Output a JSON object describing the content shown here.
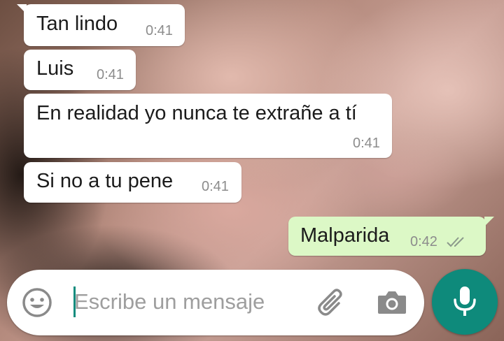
{
  "messages": [
    {
      "text": "Tan lindo",
      "time": "0:41",
      "direction": "incoming"
    },
    {
      "text": "Luis",
      "time": "0:41",
      "direction": "incoming"
    },
    {
      "text": "En realidad yo nunca te extrañe a tí",
      "time": "0:41",
      "direction": "incoming"
    },
    {
      "text": "Si no a tu pene",
      "time": "0:41",
      "direction": "incoming"
    },
    {
      "text": "Malparida",
      "time": "0:42",
      "direction": "outgoing",
      "status": "delivered"
    }
  ],
  "composer": {
    "placeholder": "Escribe un mensaje",
    "icons": [
      "smiley-icon",
      "paperclip-icon",
      "camera-icon",
      "microphone-icon"
    ]
  },
  "colors": {
    "incoming_bubble": "#ffffff",
    "outgoing_bubble": "#dcf8c6",
    "accent": "#0e8a7b",
    "timestamp": "#8c8c8c"
  }
}
